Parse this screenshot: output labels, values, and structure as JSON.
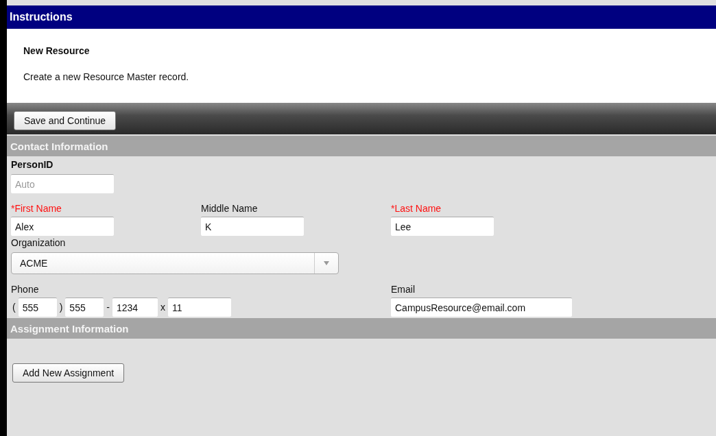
{
  "instructions": {
    "title": "Instructions",
    "heading": "New Resource",
    "text": "Create a new Resource Master record."
  },
  "toolbar": {
    "buttons": [
      "Save and Continue"
    ]
  },
  "contact_section": {
    "title": "Contact Information",
    "person_id": {
      "label": "PersonID",
      "placeholder": "Auto"
    },
    "name_fields": [
      {
        "label": "*First Name",
        "required": true,
        "value": "Alex"
      },
      {
        "label": "Middle Name",
        "required": false,
        "value": "K"
      },
      {
        "label": "*Last Name",
        "required": true,
        "value": "Lee"
      }
    ],
    "organization": {
      "label": "Organization",
      "value": "ACME"
    },
    "phone": {
      "label": "Phone",
      "open_paren": "(",
      "area_code": "555",
      "close_paren": ")",
      "prefix": "555",
      "dash": "-",
      "line_number": "1234",
      "ext_mark": "x",
      "extension": "11"
    },
    "email": {
      "label": "Email",
      "value": "CampusResource@email.com"
    }
  },
  "assignment_section": {
    "title": "Assignment Information",
    "buttons": [
      "Add New Assignment"
    ]
  }
}
